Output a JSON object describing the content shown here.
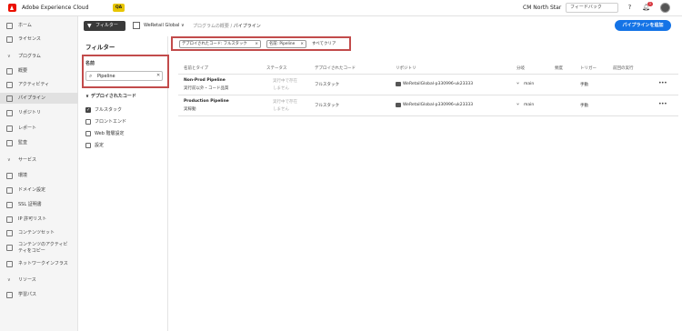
{
  "topbar": {
    "app_title": "Adobe Experience Cloud",
    "env_badge": "QA",
    "org": "CM North Star",
    "feedback": "フィードバック"
  },
  "sidebar": {
    "items": [
      {
        "label": "ホーム"
      },
      {
        "label": "ライセンス"
      },
      {
        "label": "プログラム"
      },
      {
        "label": "概要"
      },
      {
        "label": "アクティビティ"
      },
      {
        "label": "パイプライン"
      },
      {
        "label": "リポジトリ"
      },
      {
        "label": "レポート"
      },
      {
        "label": "監査"
      },
      {
        "label": "サービス"
      },
      {
        "label": "環境"
      },
      {
        "label": "ドメイン設定"
      },
      {
        "label": "SSL 証明書"
      },
      {
        "label": "IP 許可リスト"
      },
      {
        "label": "コンテンツセット"
      },
      {
        "label_line1": "コンテンツのアクティビ",
        "label_line2": "ティをコピー"
      },
      {
        "label": "ネットワークインフラス"
      },
      {
        "label": "リソース"
      },
      {
        "label": "学習パス"
      }
    ]
  },
  "toolbar": {
    "filter_label": "フィルター",
    "program": "WeRetail Global",
    "crumb1": "プログラムの概要",
    "crumb2": "パイプライン",
    "add_label": "パイプラインを追加"
  },
  "filter_panel": {
    "title": "フィルター",
    "name_label": "名前",
    "search_value": "Pipeline",
    "deploy_head": "デプロイされたコード",
    "options": [
      {
        "label": "フルスタック",
        "checked": true
      },
      {
        "label": "フロントエンド",
        "checked": false
      },
      {
        "label": "Web 階層設定",
        "checked": false
      },
      {
        "label": "設定",
        "checked": false
      }
    ]
  },
  "chips": {
    "chip1": "デプロイされたコード: フルスタック",
    "chip2": "名前: Pipeline",
    "clear_all": "すべてクリア"
  },
  "table": {
    "headers": {
      "name": "名前とタイプ",
      "status": "ステータス",
      "code": "デプロイされたコード",
      "repo": "リポジトリ",
      "branch": "分岐",
      "freq": "頻度",
      "trigger": "トリガー",
      "last": "前回の実行"
    },
    "rows": [
      {
        "name": "Non-Prod Pipeline",
        "type": "実行前以外・コード品質",
        "status_line1": "実行中で存在",
        "status_line2": "しません",
        "code": "フルスタック",
        "repo": "WeRetailGlobal-p330996-uk23333",
        "branch": "main",
        "trigger": "手動"
      },
      {
        "name": "Production Pipeline",
        "type": "実稼動",
        "status_line1": "実行中で存在",
        "status_line2": "しません",
        "code": "フルスタック",
        "repo": "WeRetailGlobal-p330996-uk23333",
        "branch": "main",
        "trigger": "手動"
      }
    ]
  },
  "colors": {
    "accent": "#1473e6",
    "highlight": "#c24b4b",
    "env_badge": "#e8c600",
    "logo": "#eb1000"
  }
}
